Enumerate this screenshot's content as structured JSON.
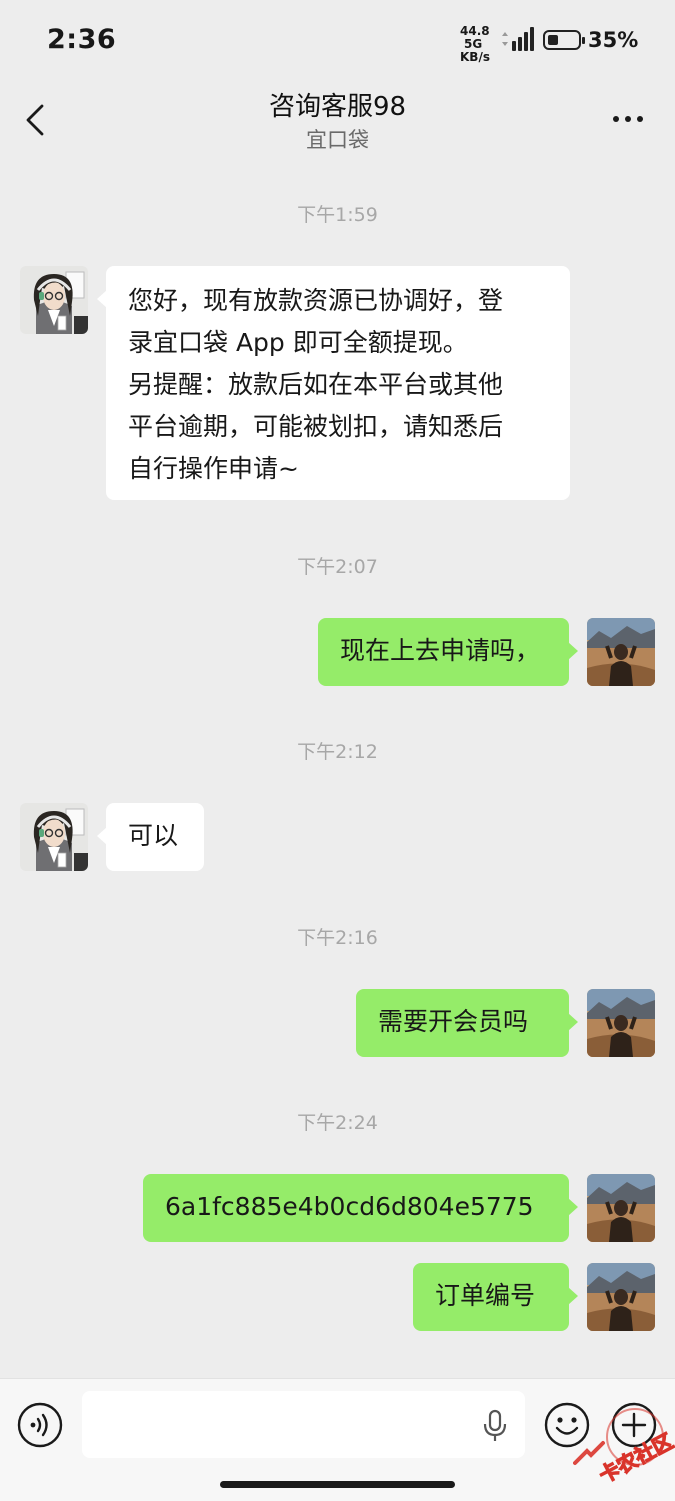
{
  "status_bar": {
    "time": "2:36",
    "network_speed": "44.8",
    "network_unit": "KB/s",
    "network_type": "5G",
    "battery_percent": "35%",
    "battery_level": 0.35
  },
  "header": {
    "title": "咨询客服98",
    "subtitle": "宜口袋",
    "back_icon": "chevron-left-icon",
    "more_icon": "more-dots-icon"
  },
  "messages": [
    {
      "type": "timestamp",
      "text": "下午1:59"
    },
    {
      "type": "message",
      "sender": "agent",
      "text": "您好，现有放款资源已协调好，登\n录宜口袋 App 即可全额提现。\n另提醒：放款后如在本平台或其他\n平台逾期，可能被划扣，请知悉后\n自行操作申请~"
    },
    {
      "type": "timestamp",
      "text": "下午2:07"
    },
    {
      "type": "message",
      "sender": "me",
      "text": "现在上去申请吗，"
    },
    {
      "type": "timestamp",
      "text": "下午2:12"
    },
    {
      "type": "message",
      "sender": "agent",
      "text": "可以"
    },
    {
      "type": "timestamp",
      "text": "下午2:16"
    },
    {
      "type": "message",
      "sender": "me",
      "text": "需要开会员吗"
    },
    {
      "type": "timestamp",
      "text": "下午2:24"
    },
    {
      "type": "message",
      "sender": "me",
      "text": "6a1fc885e4b0cd6d804e5775"
    },
    {
      "type": "message",
      "sender": "me",
      "text": "订单编号"
    }
  ],
  "input_bar": {
    "voice_icon": "voice-icon",
    "mic_icon": "mic-icon",
    "emoji_icon": "emoji-icon",
    "plus_icon": "plus-icon",
    "text": ""
  },
  "watermark": {
    "text": "卡农社区"
  },
  "colors": {
    "background": "#ededed",
    "outgoing_bubble": "#95ec69",
    "incoming_bubble": "#ffffff",
    "timestamp": "#a7a7a7"
  }
}
